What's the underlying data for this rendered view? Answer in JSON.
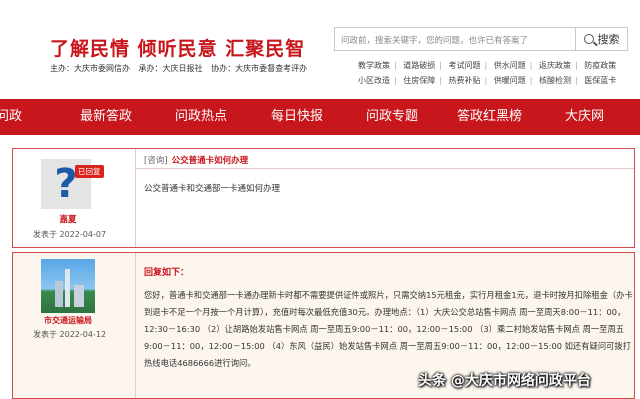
{
  "header": {
    "slogan": "了解民情  倾听民意  汇聚民智",
    "orgs": [
      "主办：大庆市委网信办",
      "承办：大庆日报社",
      "协办：大庆市委督查考评办"
    ],
    "search": {
      "placeholder": "问政前，搜索关键字，您的问题，也许已有答案了",
      "button_label": "搜索"
    },
    "tags_row1": [
      "教学政策",
      "道路破损",
      "考试问题",
      "供水问题",
      "返庆政策",
      "防疫政策"
    ],
    "tags_row2": [
      "小区改造",
      "住房保障",
      "热费补贴",
      "供暖问题",
      "核酸检测",
      "医保蓝卡"
    ]
  },
  "nav": {
    "items": [
      "问政",
      "最新答政",
      "问政热点",
      "每日快报",
      "问政专题",
      "答政红黑榜",
      "大庆网"
    ]
  },
  "question": {
    "badge": "已回复",
    "asker": "嘉夏",
    "date": "发表于 2022-04-07",
    "tag": "[咨询]",
    "title": "公交普通卡如何办理",
    "body": "公交普通卡和交通部一卡通如何办理"
  },
  "answer": {
    "responder": "市交通运输局",
    "date": "发表于 2022-04-12",
    "header": "回复如下：",
    "body": "您好，普通卡和交通部一卡通办理新卡时都不需要提供证件或照片，只需交纳15元租金，实行月租金1元，退卡时按月扣除租金（办卡到退卡不足一个月按一个月计算），充值时每次最低充值30元。办理地点：（1）大庆公交总站售卡网点 周一至周天8:00－11：00，12:30－16:30 （2）让胡路始发站售卡网点 周一至周五9:00－11：00，12:00－15:00 （3）乘二村始发站售卡网点 周一至周五9:00－11：00，12:00－15:00 （4）东风（益民）始发站售卡网点 周一至周五9:00－11：00，12:00－15:00 如还有疑问可拨打热线电话4686666进行询问。"
  },
  "watermark": "头条 @大庆市网络问政平台"
}
